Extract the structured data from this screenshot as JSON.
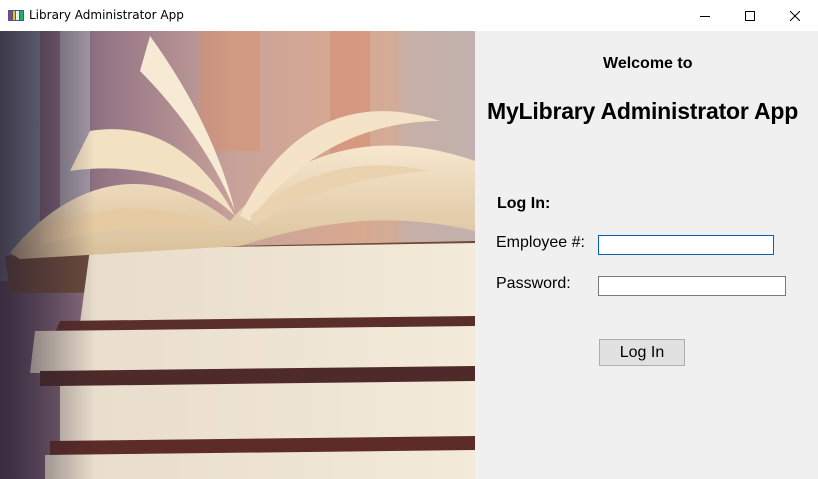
{
  "window": {
    "title": "Library Administrator App",
    "app_icon": "library-app-icon",
    "controls": {
      "minimize": "minimize-icon",
      "maximize": "maximize-icon",
      "close": "close-icon"
    }
  },
  "hero_image": {
    "subject": "open-book-on-stack-of-books",
    "icon": "books-illustration"
  },
  "panel": {
    "welcome": "Welcome to",
    "app_title": "MyLibrary Administrator App",
    "login_heading": "Log In:",
    "employee_label": "Employee #:",
    "employee_value": "",
    "password_label": "Password:",
    "password_value": "",
    "login_button": "Log In"
  },
  "colors": {
    "panel_bg": "#f0f0f0",
    "focus_border": "#0063b1",
    "button_bg": "#e1e1e1"
  }
}
